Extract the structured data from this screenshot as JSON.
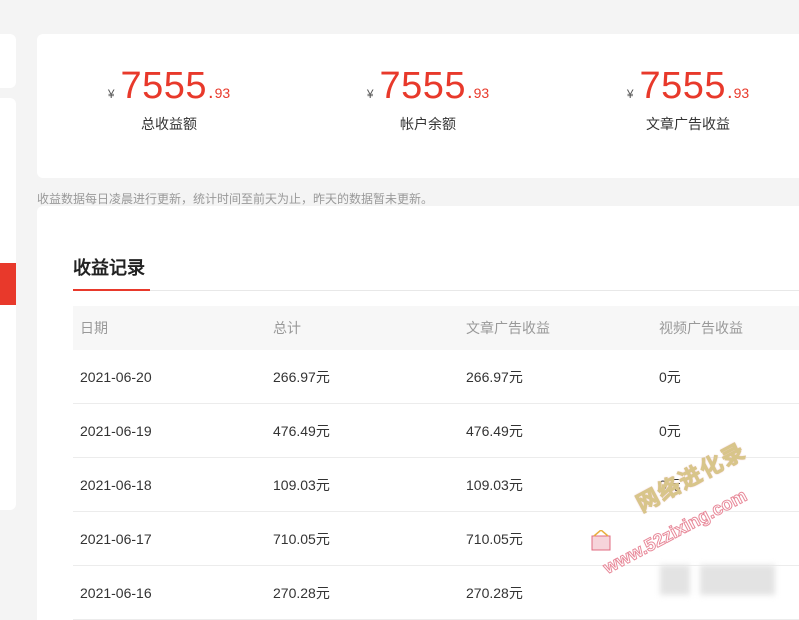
{
  "summary": [
    {
      "currency": "¥",
      "int": "7555",
      "dot": ".",
      "dec": "93",
      "label": "总收益额"
    },
    {
      "currency": "¥",
      "int": "7555",
      "dot": ".",
      "dec": "93",
      "label": "帐户余额"
    },
    {
      "currency": "¥",
      "int": "7555",
      "dot": ".",
      "dec": "93",
      "label": "文章广告收益"
    }
  ],
  "note": "收益数据每日凌晨进行更新，统计时间至前天为止，昨天的数据暂未更新。",
  "records": {
    "title": "收益记录",
    "columns": [
      "日期",
      "总计",
      "文章广告收益",
      "视频广告收益"
    ],
    "rows": [
      [
        "2021-06-20",
        "266.97元",
        "266.97元",
        "0元"
      ],
      [
        "2021-06-19",
        "476.49元",
        "476.49元",
        "0元"
      ],
      [
        "2021-06-18",
        "109.03元",
        "109.03元",
        "0元"
      ],
      [
        "2021-06-17",
        "710.05元",
        "710.05元",
        ""
      ],
      [
        "2021-06-16",
        "270.28元",
        "270.28元",
        ""
      ]
    ]
  },
  "watermark": {
    "line1": "网络进化录",
    "line2": "www.52zixing.com"
  },
  "colors": {
    "accent": "#e8392b",
    "background": "#f4f4f4",
    "muted": "#999999"
  }
}
